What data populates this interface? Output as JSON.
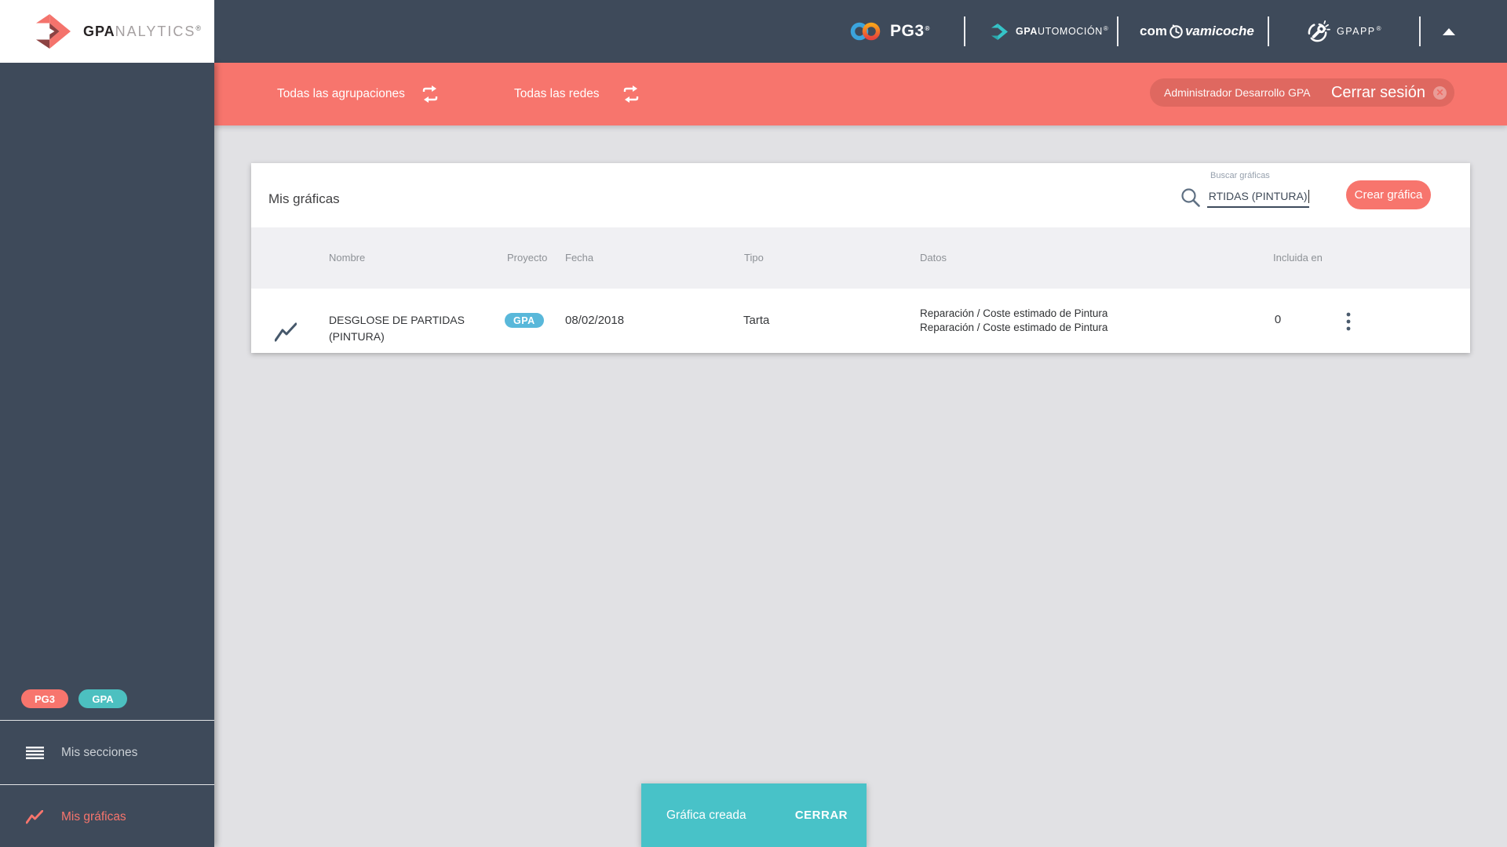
{
  "brand": {
    "bold": "GPA",
    "light": "NALYTICS",
    "reg": "®"
  },
  "topbar": {
    "pg3": "PG3",
    "auto_bold": "GPA",
    "auto_rest": "UTOMOCIÓN",
    "comprova_pre": "com",
    "comprova_post": "vamicoche",
    "gpapp": "GPAPP",
    "reg": "®"
  },
  "filterbar": {
    "groupings": "Todas las agrupaciones",
    "networks": "Todas las redes",
    "user": "Administrador Desarrollo GPA",
    "logout": "Cerrar sesión"
  },
  "sidebar": {
    "badges": [
      {
        "label": "PG3"
      },
      {
        "label": "GPA"
      }
    ],
    "items": [
      {
        "label": "Mis secciones"
      },
      {
        "label": "Mis gráficas",
        "active": true
      }
    ]
  },
  "card": {
    "title": "Mis gráficas",
    "search_label": "Buscar gráficas",
    "search_value": "RTIDAS (PINTURA)",
    "create_label": "Crear gráfica"
  },
  "table": {
    "headers": [
      "Nombre",
      "Proyecto",
      "Fecha",
      "Tipo",
      "Datos",
      "Incluida en"
    ],
    "rows": [
      {
        "name": "DESGLOSE DE PARTIDAS (PINTURA)",
        "project_badge": "GPA",
        "date": "08/02/2018",
        "type": "Tarta",
        "data": [
          "Reparación / Coste estimado de Pintura",
          "Reparación / Coste estimado de Pintura"
        ],
        "included_in": "0"
      }
    ]
  },
  "snackbar": {
    "message": "Gráfica creada",
    "action": "CERRAR"
  },
  "colors": {
    "dark_slate": "#3e4a5a",
    "salmon": "#f7756d",
    "maroon": "#8c4242",
    "teal_badge": "#4cc0c0",
    "blue_badge": "#59b8da",
    "snackbar_teal": "#48c2c8",
    "page_bg": "#e1e1e4",
    "table_head_bg": "#f0f0f3"
  },
  "icons": [
    "gpa-arrow-icon",
    "infinity-icon",
    "teal-arrow-icon",
    "clock-icon",
    "wrench-circle-icon",
    "swap-icon",
    "logout-x-icon",
    "menu-icon",
    "line-chart-icon",
    "search-icon",
    "kebab-menu-icon",
    "collapse-caret-icon"
  ]
}
